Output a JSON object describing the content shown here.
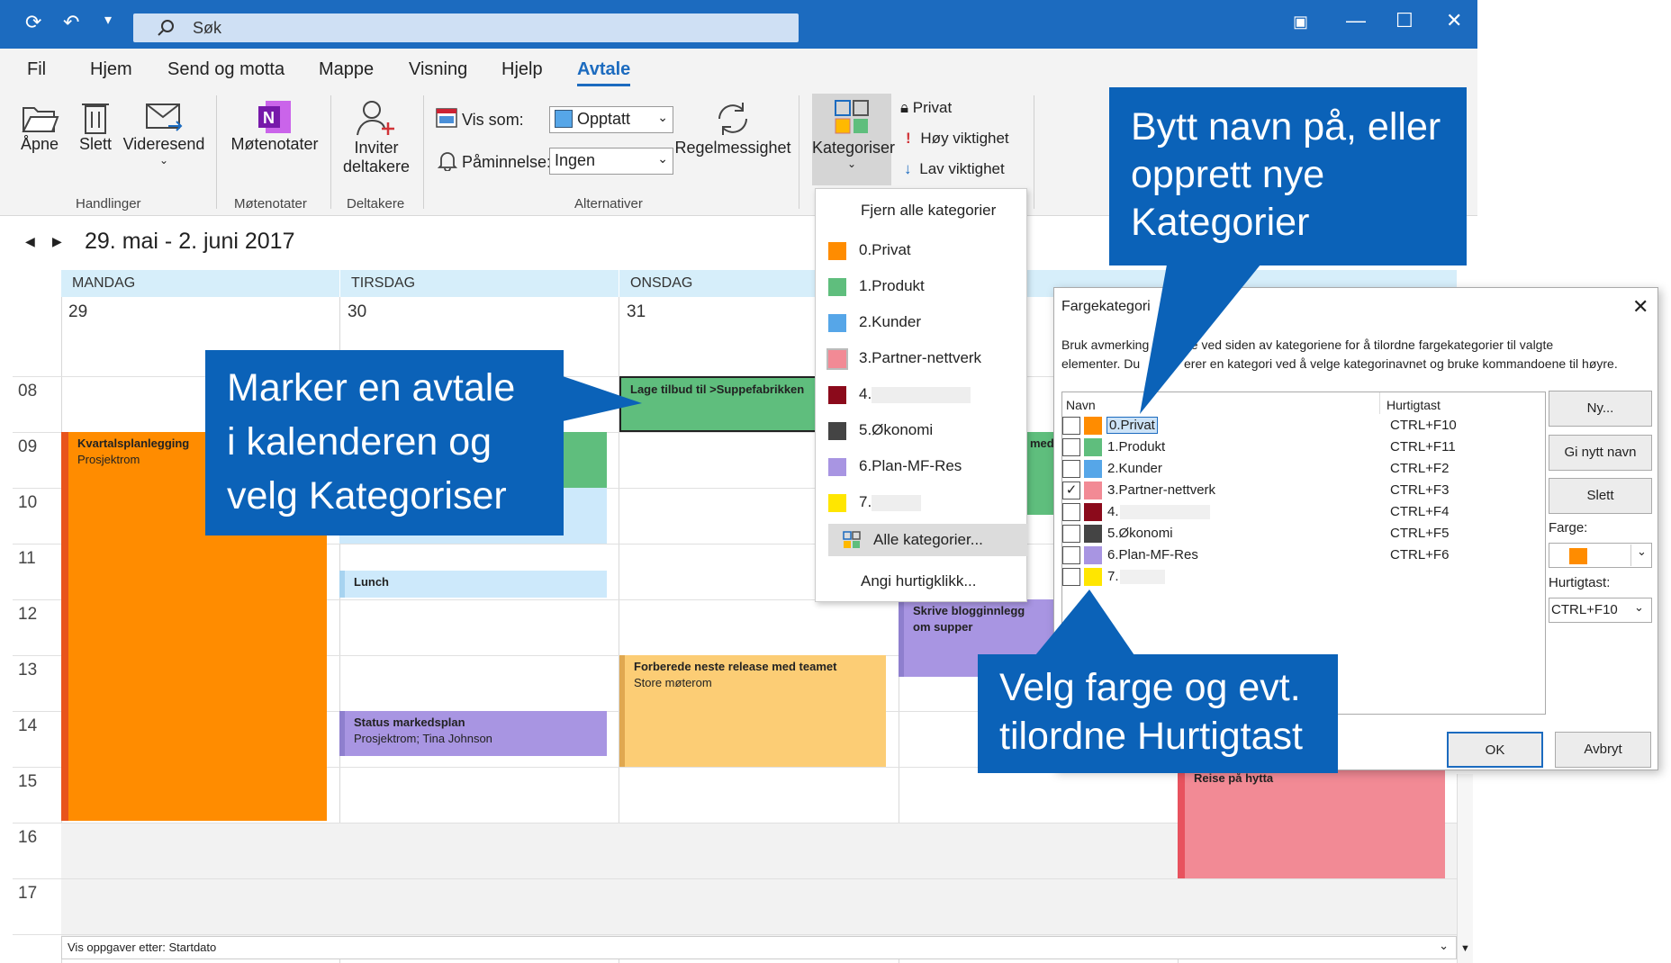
{
  "search": {
    "placeholder": "Søk"
  },
  "tabs": [
    "Fil",
    "Hjem",
    "Send og motta",
    "Mappe",
    "Visning",
    "Hjelp",
    "Avtale"
  ],
  "ribbon": {
    "open": "Åpne",
    "delete": "Slett",
    "forward": "Videresend",
    "meeting_notes": "Møtenotater",
    "invite1": "Inviter",
    "invite2": "deltakere",
    "show_as_label": "Vis som:",
    "show_as_value": "Opptatt",
    "reminder_label": "Påminnelse:",
    "reminder_value": "Ingen",
    "recurrence": "Regelmessighet",
    "categorize": "Kategoriser",
    "private": "Privat",
    "high": "Høy viktighet",
    "low": "Lav viktighet",
    "groups": {
      "actions": "Handlinger",
      "notes": "Møtenotater",
      "attendees": "Deltakere",
      "options": "Alternativer"
    }
  },
  "calendar": {
    "range": "29. mai - 2. juni 2017",
    "days": [
      {
        "name": "MANDAG",
        "num": "29"
      },
      {
        "name": "TIRSDAG",
        "num": "30"
      },
      {
        "name": "ONSDAG",
        "num": "31"
      }
    ],
    "hours": [
      "08",
      "09",
      "10",
      "11",
      "12",
      "13",
      "14",
      "15",
      "16",
      "17"
    ],
    "events": {
      "kvartal_title": "Kvartalsplanlegging",
      "kvartal_loc": "Prosjektrom",
      "lunch": "Lunch",
      "status_title": "Status markedsplan",
      "status_loc": "Prosjektrom; Tina Johnson",
      "tilbud": "Lage tilbud til >Suppefabrikken",
      "release_title": "Forberede neste release med teamet",
      "release_loc": "Store møterom",
      "blogg": "Skrive blogginnlegg om supper",
      "med": "med",
      "reise": "Reise på hytta"
    },
    "tasks_bar": "Vis oppgaver etter: Startdato"
  },
  "dropdown": {
    "clear_all": "Fjern alle kategorier",
    "items": [
      "0.Privat",
      "1.Produkt",
      "2.Kunder",
      "3.Partner-nettverk",
      "4.",
      "5.Økonomi",
      "6.Plan-MF-Res",
      "7."
    ],
    "all": "Alle kategorier...",
    "quick": "Angi hurtigklikk..."
  },
  "dialog": {
    "title": "Fargekategori",
    "desc1": "Bruk avmerking",
    "desc1b": "ne ved siden av kategoriene for å tilordne fargekategorier til valgte",
    "desc2": "elementer. Du",
    "desc2b": "erer en kategori ved å velge kategorinavnet og bruke kommandoene til høyre.",
    "col_name": "Navn",
    "col_key": "Hurtigtast",
    "rows": [
      {
        "name": "0.Privat",
        "key": "CTRL+F10",
        "checked": ""
      },
      {
        "name": "1.Produkt",
        "key": "CTRL+F11",
        "checked": ""
      },
      {
        "name": "2.Kunder",
        "key": "CTRL+F2",
        "checked": ""
      },
      {
        "name": "3.Partner-nettverk",
        "key": "CTRL+F3",
        "checked": "✓"
      },
      {
        "name": "4.",
        "key": "CTRL+F4",
        "checked": ""
      },
      {
        "name": "5.Økonomi",
        "key": "CTRL+F5",
        "checked": ""
      },
      {
        "name": "6.Plan-MF-Res",
        "key": "CTRL+F6",
        "checked": ""
      },
      {
        "name": "7.",
        "key": "",
        "checked": ""
      }
    ],
    "btn_new": "Ny...",
    "btn_rename": "Gi nytt navn",
    "btn_delete": "Slett",
    "color_label": "Farge:",
    "key_label": "Hurtigtast:",
    "key_value": "CTRL+F10",
    "ok": "OK",
    "cancel": "Avbryt"
  },
  "callouts": {
    "c1": [
      "Marker en avtale",
      "i kalenderen og",
      "velg Kategoriser"
    ],
    "c2": [
      "Bytt navn på, eller",
      "opprett nye",
      "Kategorier"
    ],
    "c3": [
      "Velg farge og evt.",
      "tilordne Hurtigtast"
    ]
  },
  "colors": {
    "privat": "#ff8c00",
    "produkt": "#5fbe7d",
    "kunder": "#56a6e8",
    "partner": "#f28a95",
    "c4": "#8b0a1b",
    "okonomi": "#444444",
    "plan": "#a895e2",
    "c7": "#ffe600"
  }
}
